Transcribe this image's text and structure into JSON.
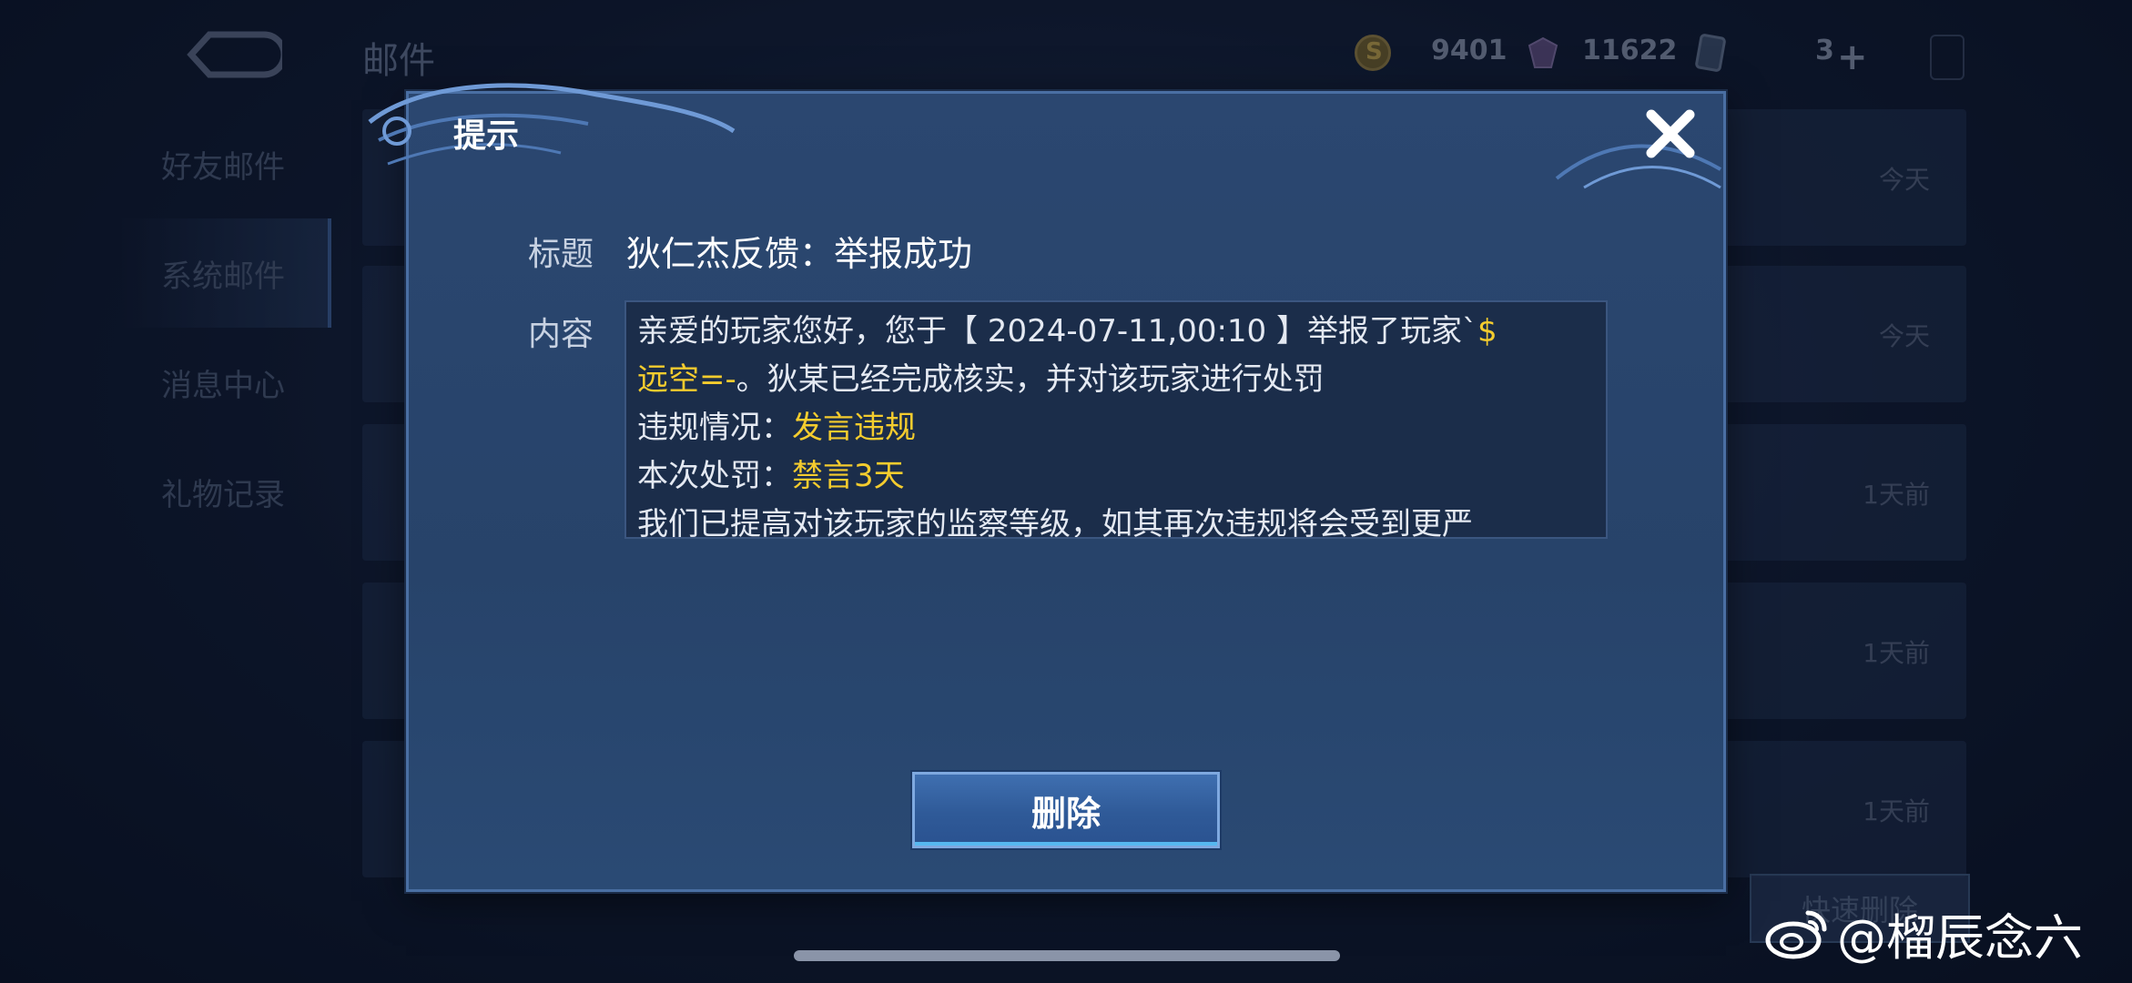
{
  "app": {
    "page_title": "邮件",
    "gold": "9401",
    "diamonds": "11622",
    "tickets": "3"
  },
  "sidebar": {
    "items": [
      {
        "label": "好友邮件"
      },
      {
        "label": "系统邮件"
      },
      {
        "label": "消息中心"
      },
      {
        "label": "礼物记录"
      }
    ]
  },
  "mail_list": {
    "dates": [
      "今天",
      "今天",
      "1天前",
      "1天前",
      "1天前"
    ],
    "quick_delete_label": "快速删除"
  },
  "dialog": {
    "title": "提示",
    "subject_label": "标题",
    "subject": "狄仁杰反馈：举报成功",
    "content_label": "内容",
    "content": {
      "line1_a": "亲爱的玩家您好，您于【 2024-07-11,00:10 】举报了玩家`",
      "line1_b": "$",
      "line2_a": "远空=-",
      "line2_b": "。狄某已经完成核实，并对该玩家进行处罚",
      "line3_a": "违规情况：",
      "line3_b": "发言违规",
      "line4_a": "本次处罚：",
      "line4_b": "禁言3天",
      "line5": "我们已提高对该玩家的监察等级，如其再次违规将会受到更严"
    },
    "delete_label": "删除"
  },
  "watermark": "@榴辰念六",
  "colors": {
    "highlight": "#f4cc2e",
    "dialog_bg": "#2b4770",
    "button": "#3f6fb0"
  }
}
